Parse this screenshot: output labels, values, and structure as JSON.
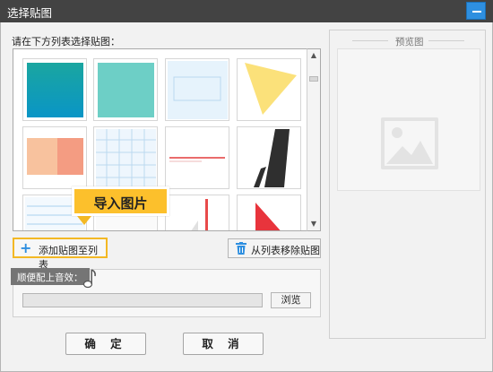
{
  "window": {
    "title": "选择贴图",
    "close_icon": "close-icon"
  },
  "picker": {
    "instruction": "请在下方列表选择贴图：",
    "thumbnails": [
      "teal-gradient",
      "mint-square",
      "light-blue-frame",
      "yellow-triangle",
      "coral-blocks",
      "blue-grid",
      "red-line",
      "black-stripes",
      "blue-lines",
      "white-shapes",
      "red-bar",
      "red-triangle"
    ]
  },
  "tooltip": {
    "label": "导入图片"
  },
  "buttons": {
    "add_label": "添加贴图至列表",
    "remove_label": "从列表移除贴图",
    "browse_label": "浏览",
    "ok_label": "确 定",
    "cancel_label": "取 消"
  },
  "sound": {
    "label": "顺便配上音效：",
    "value": ""
  },
  "preview": {
    "label": "预览图"
  },
  "colors": {
    "accent": "#2e8fe0",
    "tooltip": "#fcc02c",
    "title_bar": "#434343"
  }
}
